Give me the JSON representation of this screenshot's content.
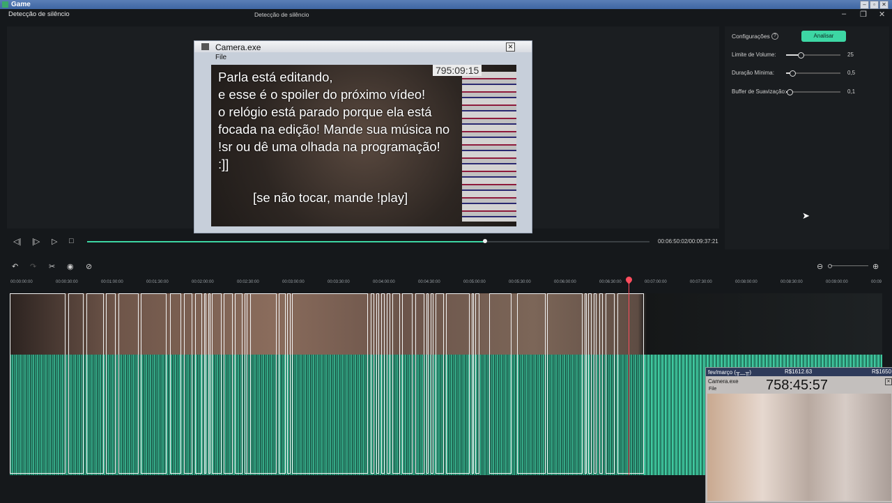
{
  "os": {
    "title": "Game"
  },
  "header": {
    "app_title": "Detecção de silêncio",
    "center_title": "Detecção de silêncio"
  },
  "camera_window": {
    "title": "Camera.exe",
    "menu": "File",
    "clock": "795:09:15",
    "overlay_text": "Parla está editando,\ne esse é o spoiler do próximo vídeo!\no relógio está parado porque ela está\nfocada na edição! Mande sua música no\n!sr ou dê uma olhada na programação!\n:]]",
    "overlay_sub": "[se não tocar, mande !play]",
    "close_glyph": "✕"
  },
  "settings": {
    "label": "Configurações",
    "help_glyph": "?",
    "analyze_button": "Analisar",
    "rows": [
      {
        "label": "Limite de Volume:",
        "value": "25",
        "level": 0.27
      },
      {
        "label": "Duração Mínima:",
        "value": "0,5",
        "level": 0.12
      },
      {
        "label": "Buffer de Suavização:",
        "value": "0,1",
        "level": 0.06
      }
    ]
  },
  "transport": {
    "progress": 0.707,
    "time": "00:06:50:02/00:09:37:21",
    "icons": [
      "prev-frame-icon",
      "next-frame-icon",
      "play-icon",
      "stop-icon"
    ]
  },
  "ruler": {
    "ticks": [
      "00:00:00:00",
      "00:00:30:00",
      "00:01:00:00",
      "00:01:30:00",
      "00:02:00:00",
      "00:02:30:00",
      "00:03:00:00",
      "00:03:30:00",
      "00:04:00:00",
      "00:04:30:00",
      "00:05:00:00",
      "00:05:30:00",
      "00:06:00:00",
      "00:06:30:00",
      "00:07:00:00",
      "00:07:30:00",
      "00:08:00:00",
      "00:08:30:00",
      "00:09:00:00",
      "00:09"
    ]
  },
  "pip": {
    "label_left": "fev/março (╥﹏╥)",
    "label_mid": "R$1612.63",
    "label_right": "R$1650",
    "title": "Camera.exe",
    "menu": "File",
    "clock": "758:45:57"
  },
  "colors": {
    "accent": "#3dd7a4",
    "playhead": "#ff4d5e"
  }
}
